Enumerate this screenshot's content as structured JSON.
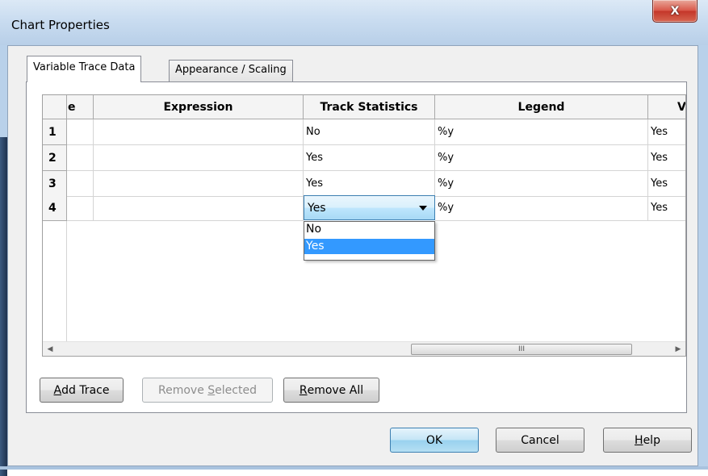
{
  "window": {
    "title": "Chart Properties",
    "close_glyph": "X"
  },
  "tabs": [
    {
      "label": "Variable Trace Data",
      "active": true
    },
    {
      "label": "Appearance / Scaling",
      "active": false
    }
  ],
  "grid": {
    "columns": [
      "e",
      "Expression",
      "Track Statistics",
      "Legend",
      "V"
    ],
    "rows": [
      {
        "num": "1",
        "e": "",
        "expression": "",
        "track_statistics": "No",
        "legend": "%y",
        "v": "Yes"
      },
      {
        "num": "2",
        "e": "",
        "expression": "",
        "track_statistics": "Yes",
        "legend": "%y",
        "v": "Yes"
      },
      {
        "num": "3",
        "e": "",
        "expression": "",
        "track_statistics": "Yes",
        "legend": "%y",
        "v": "Yes"
      },
      {
        "num": "4",
        "e": "",
        "expression": "",
        "track_statistics": "Yes",
        "legend": "%y",
        "v": "Yes"
      }
    ],
    "dropdown": {
      "value": "Yes",
      "options": [
        "No",
        "Yes"
      ],
      "highlighted": "Yes"
    },
    "scrollbar": {
      "thumb_grip": "III"
    }
  },
  "buttons": {
    "add_trace": {
      "pre": "",
      "u": "A",
      "post": "dd Trace"
    },
    "remove_selected": {
      "pre": "Remove ",
      "u": "S",
      "post": "elected"
    },
    "remove_all": {
      "pre": "",
      "u": "R",
      "post": "emove All"
    },
    "ok": {
      "label": "OK"
    },
    "cancel": {
      "label": "Cancel"
    },
    "help": {
      "pre": "",
      "u": "H",
      "post": "elp"
    }
  },
  "colors": {
    "selection": "#3399ff",
    "title_bar": "#c9dcf0",
    "close_button": "#c4372a"
  }
}
